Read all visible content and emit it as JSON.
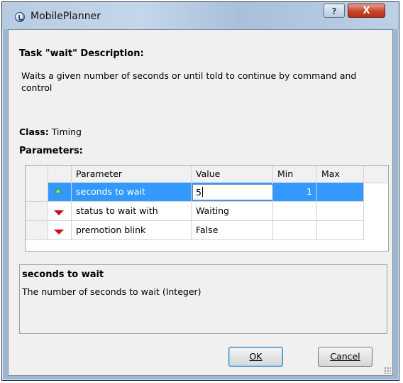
{
  "window": {
    "title": "MobilePlanner",
    "help_label": "?",
    "close_label": "X"
  },
  "task": {
    "heading": "Task \"wait\" Description:",
    "description": "Waits a given number of seconds or until told to continue by command and control",
    "class_label": "Class:",
    "class_value": "Timing",
    "parameters_label": "Parameters:"
  },
  "grid": {
    "columns": [
      "Parameter",
      "Value",
      "Min",
      "Max"
    ],
    "rows": [
      {
        "icon": "arrow-up-icon",
        "parameter": "seconds to wait",
        "value": "5",
        "min": "1",
        "max": "",
        "selected": true
      },
      {
        "icon": "arrow-down-icon",
        "parameter": "status to wait with",
        "value": "Waiting",
        "min": "",
        "max": "",
        "selected": false
      },
      {
        "icon": "arrow-down-icon",
        "parameter": "premotion blink",
        "value": "False",
        "min": "",
        "max": "",
        "selected": false
      }
    ]
  },
  "info": {
    "title": "seconds to wait",
    "text": "The number of seconds to wait (Integer)"
  },
  "buttons": {
    "ok_label": "OK",
    "cancel_label": "Cancel"
  },
  "colors": {
    "selection": "#3399ff",
    "up_arrow": "#2e9c4f",
    "down_arrow": "#d01010",
    "close_button": "#c8432b"
  }
}
